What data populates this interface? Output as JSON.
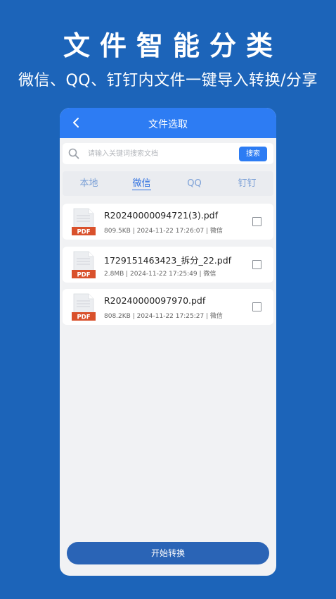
{
  "promo": {
    "title": "文件智能分类",
    "subtitle": "微信、QQ、钉钉内文件一键导入转换/分享"
  },
  "app": {
    "title": "文件选取",
    "search": {
      "placeholder": "请输入关键词搜索文档",
      "button": "搜索"
    },
    "tabs": [
      {
        "label": "本地",
        "active": false
      },
      {
        "label": "微信",
        "active": true
      },
      {
        "label": "QQ",
        "active": false
      },
      {
        "label": "钉钉",
        "active": false
      }
    ],
    "files": [
      {
        "name": "R20240000094721(3).pdf",
        "meta": "809.5KB | 2024-11-22 17:26:07 | 微信",
        "type_label": "PDF",
        "checked": false
      },
      {
        "name": "1729151463423_拆分_22.pdf",
        "meta": "2.8MB | 2024-11-22 17:25:49 | 微信",
        "type_label": "PDF",
        "checked": false
      },
      {
        "name": "R20240000097970.pdf",
        "meta": "808.2KB | 2024-11-22 17:25:27 | 微信",
        "type_label": "PDF",
        "checked": false
      }
    ],
    "start_button": "开始转换"
  },
  "colors": {
    "background": "#1c64b9",
    "accent": "#2d7cf3",
    "pdf_badge": "#d9512c",
    "start_button": "#2a64b6"
  },
  "icons": {
    "back": "chevron-left-icon",
    "search": "search-icon",
    "file": "pdf-file-icon",
    "select": "checkbox-icon"
  }
}
